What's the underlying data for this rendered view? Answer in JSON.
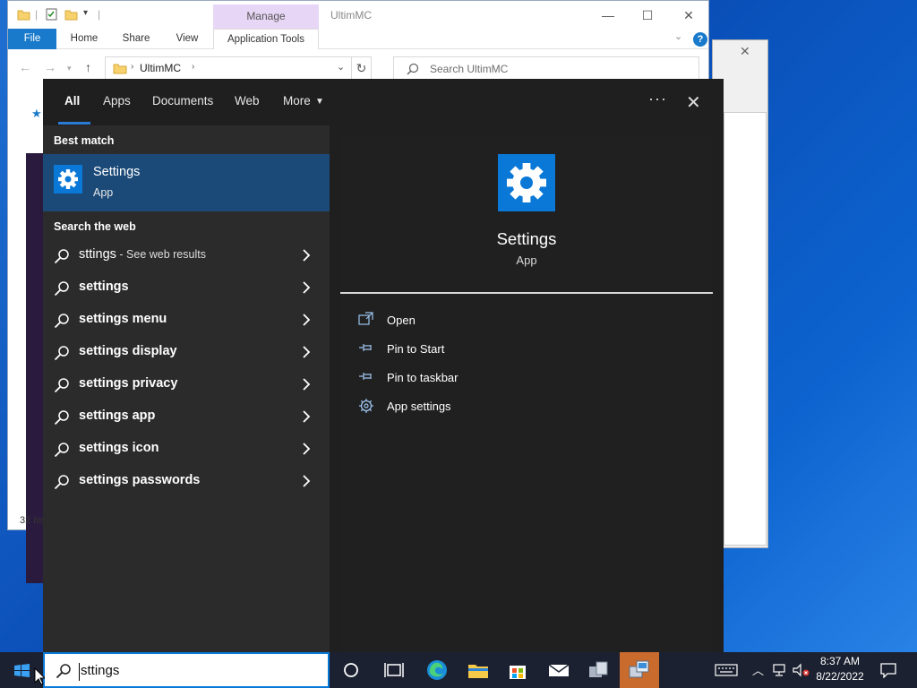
{
  "explorer": {
    "title": "UltimMC",
    "manage_tab": "Manage",
    "ribbon_tabs": {
      "file": "File",
      "home": "Home",
      "share": "Share",
      "view": "View",
      "app_tools": "Application Tools"
    },
    "address": "UltimMC",
    "search_placeholder": "Search UltimMC",
    "status": "32 ite"
  },
  "search_flyout": {
    "tabs": {
      "all": "All",
      "apps": "Apps",
      "documents": "Documents",
      "web": "Web",
      "more": "More"
    },
    "best_match_heading": "Best match",
    "best_match": {
      "title": "Settings",
      "subtitle": "App"
    },
    "search_web_heading": "Search the web",
    "web_first": {
      "query": "sttings",
      "suffix": " - See web results"
    },
    "web_results": [
      "settings",
      "settings menu",
      "settings display",
      "settings privacy",
      "settings app",
      "settings icon",
      "settings passwords"
    ],
    "preview": {
      "title": "Settings",
      "subtitle": "App"
    },
    "actions": {
      "open": "Open",
      "pin_start": "Pin to Start",
      "pin_taskbar": "Pin to taskbar",
      "app_settings": "App settings"
    }
  },
  "taskbar": {
    "search_value": "sttings",
    "time": "8:37 AM",
    "date": "8/22/2022"
  },
  "colors": {
    "accent": "#0a78d7",
    "best_match_bg": "#1b4a78",
    "active_app": "#c86b2c",
    "taskbar": "#1b2130"
  }
}
